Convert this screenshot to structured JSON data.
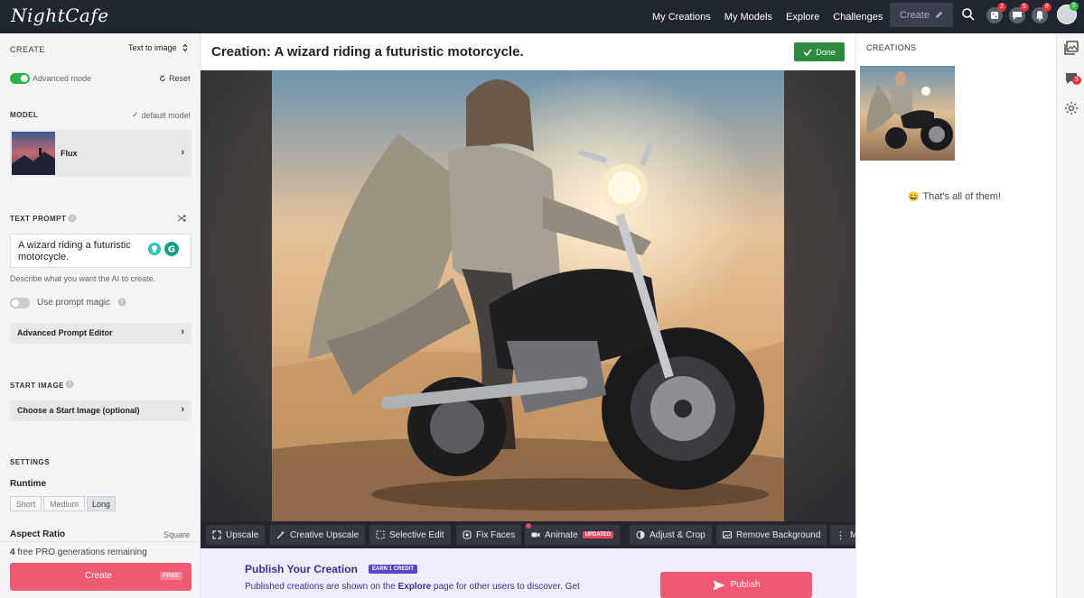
{
  "nav": {
    "logo": "NightCafe",
    "links": [
      "My Creations",
      "My Models",
      "Explore",
      "Challenges"
    ],
    "create_label": "Create",
    "badges": {
      "dice": "2",
      "chat": "5",
      "bell": "8",
      "avatar": "5"
    }
  },
  "left": {
    "create_label": "CREATE",
    "mode_select": "Text to image",
    "advanced_mode": "Advanced mode",
    "reset": "Reset",
    "model_label": "MODEL",
    "default_model": "default model",
    "model_name": "Flux",
    "text_prompt_label": "TEXT PROMPT",
    "prompt_value": "A wizard riding a futuristic motorcycle.",
    "prompt_hint": "Describe what you want the AI to create.",
    "prompt_magic": "Use prompt magic",
    "advanced_prompt_editor": "Advanced Prompt Editor",
    "start_image_label": "START IMAGE",
    "start_image_btn": "Choose a Start Image (optional)",
    "settings_label": "SETTINGS",
    "runtime_label": "Runtime",
    "runtime_options": [
      "Short",
      "Medium",
      "Long"
    ],
    "runtime_selected": "Long",
    "aspect_label": "Aspect Ratio",
    "aspect_value": "Square",
    "pro_count": "4",
    "pro_remaining": "free PRO generations remaining",
    "create_btn": "Create",
    "free_tag": "FREE"
  },
  "center": {
    "title": "Creation: A wizard riding a futuristic motorcycle.",
    "done": "Done",
    "tools": [
      "Upscale",
      "Creative Upscale",
      "Selective Edit",
      "Fix Faces",
      "Animate",
      "Adjust & Crop",
      "Remove Background"
    ],
    "updated_tag": "UPDATED",
    "more_label": "M",
    "publish_title": "Publish Your Creation",
    "earn_tag": "EARN 1 CREDIT",
    "publish_desc_pre": "Published creations are shown on the ",
    "publish_desc_bold": "Explore",
    "publish_desc_post": " page for other users to discover. Get",
    "publish_btn": "Publish"
  },
  "right": {
    "creations_label": "CREATIONS",
    "end_emoji": "😀",
    "end_text": "That's all of them!",
    "chat_badge": "5"
  },
  "colors": {
    "nav_bg": "#202630",
    "accent_pink": "#ee5a72",
    "done_green": "#2d8a3e",
    "toggle_green": "#2eb24c",
    "publish_bg": "#f0ecfb",
    "publish_text": "#3d2f8a"
  }
}
